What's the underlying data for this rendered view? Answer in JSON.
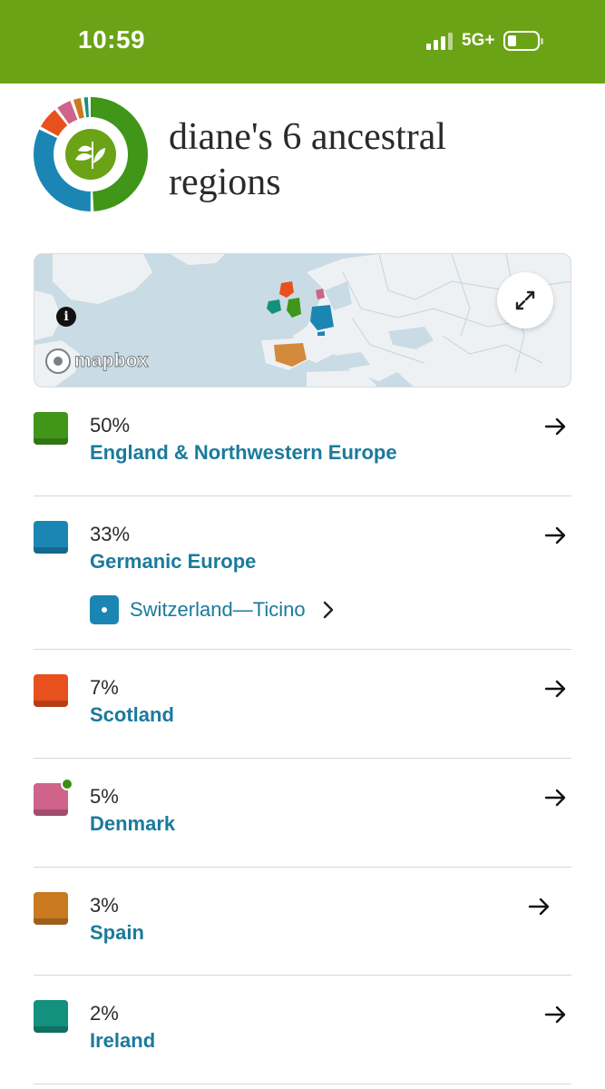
{
  "status_bar": {
    "time": "10:59",
    "network": "5G+"
  },
  "header": {
    "title": "diane's 6 ancestral regions"
  },
  "map": {
    "attribution": "mapbox",
    "info_symbol": "i"
  },
  "colors": {
    "brand_green": "#6aa315",
    "link_blue": "#1b7a9c",
    "england": "#3f9618",
    "germanic": "#1b86b4",
    "scotland": "#e8501d",
    "denmark": "#cf6389",
    "spain": "#c97a20",
    "ireland": "#14907e"
  },
  "regions": [
    {
      "percent": "50%",
      "name": "England & Northwestern Europe",
      "color": "#3f9618"
    },
    {
      "percent": "33%",
      "name": "Germanic Europe",
      "color": "#1b86b4",
      "subregion": "Switzerland—Ticino"
    },
    {
      "percent": "7%",
      "name": "Scotland",
      "color": "#e8501d"
    },
    {
      "percent": "5%",
      "name": "Denmark",
      "color": "#cf6389",
      "new_indicator": true
    },
    {
      "percent": "3%",
      "name": "Spain",
      "color": "#c97a20"
    },
    {
      "percent": "2%",
      "name": "Ireland",
      "color": "#14907e"
    }
  ]
}
